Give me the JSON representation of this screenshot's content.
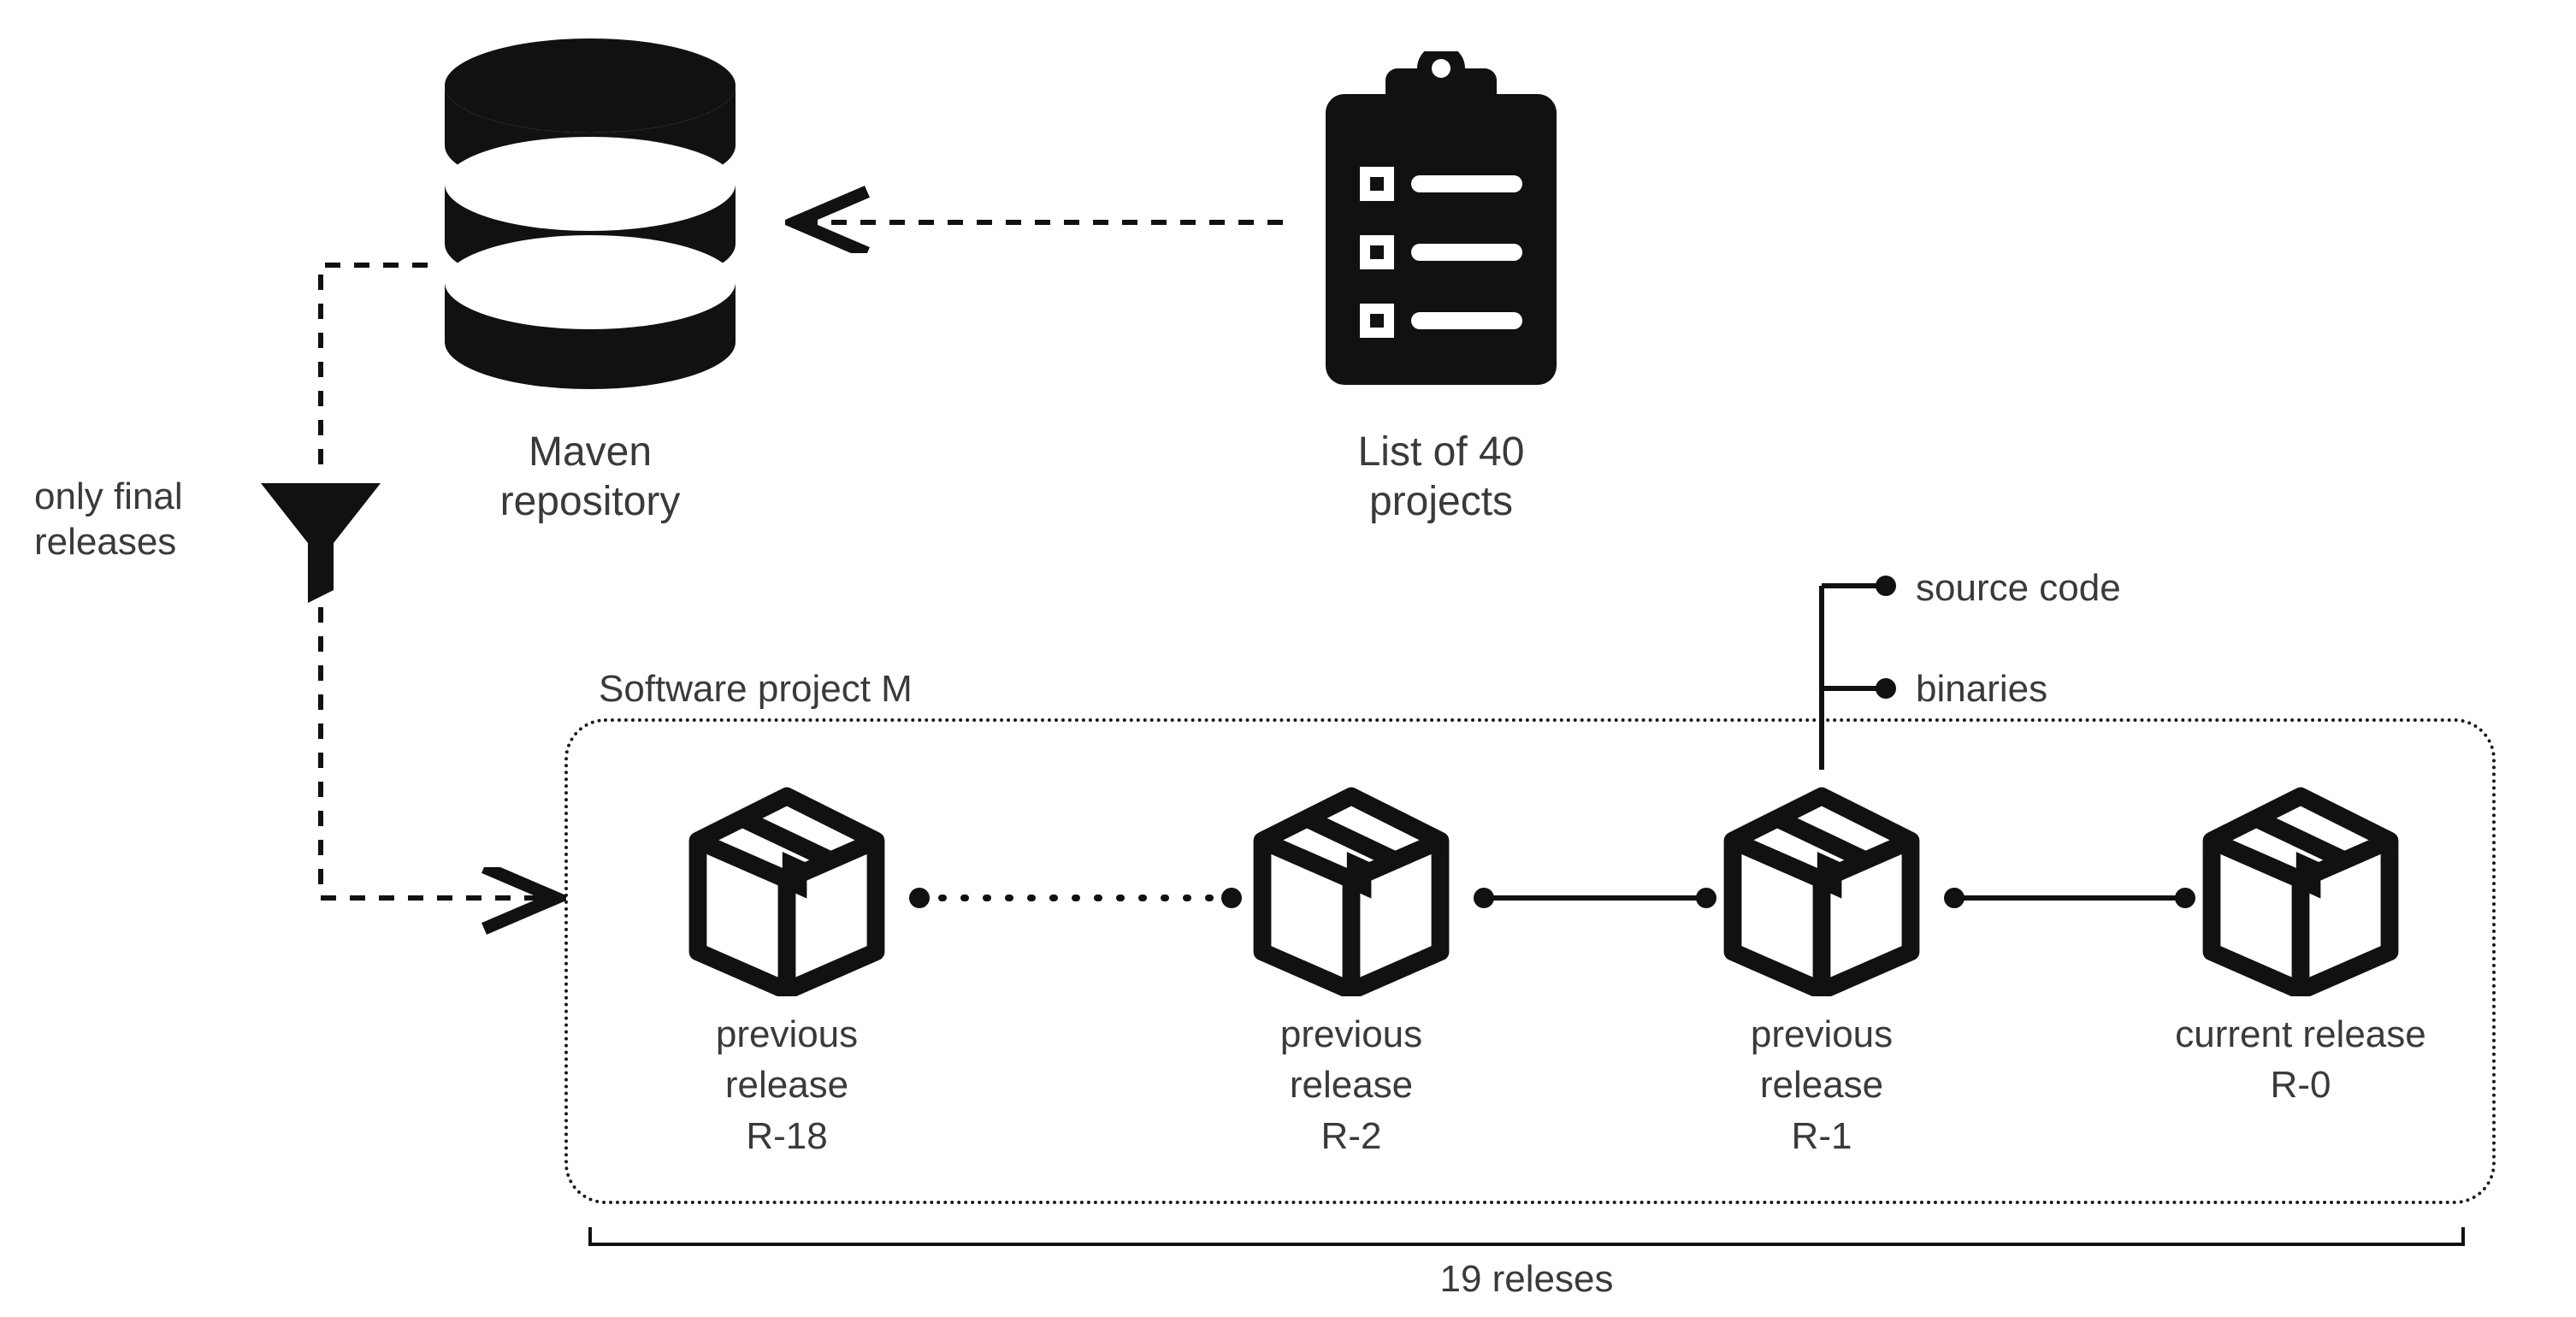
{
  "clipboard": {
    "label_line1": "List of 40",
    "label_line2": "projects"
  },
  "database": {
    "label_line1": "Maven",
    "label_line2": "repository"
  },
  "filter": {
    "label_line1": "only final",
    "label_line2": "releases"
  },
  "project": {
    "title": "Software project M"
  },
  "releases": {
    "r18": {
      "line1": "previous release",
      "line2": "R-18"
    },
    "r2": {
      "line1": "previous release",
      "line2": "R-2"
    },
    "r1": {
      "line1": "previous release",
      "line2": "R-1"
    },
    "r0": {
      "line1": "current release",
      "line2": "R-0"
    }
  },
  "contents": {
    "item1": "source code",
    "item2": "binaries"
  },
  "bracket": {
    "label": "19 releses"
  }
}
